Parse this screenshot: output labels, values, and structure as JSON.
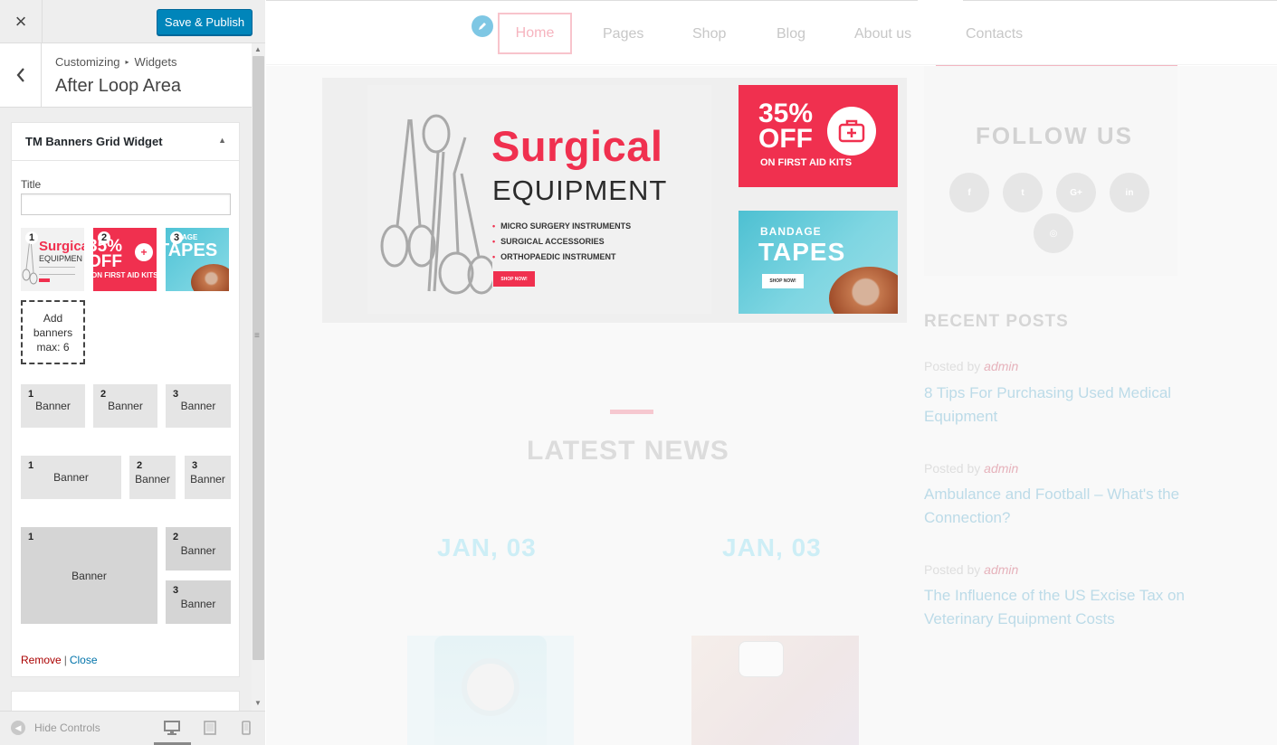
{
  "header": {
    "close_label": "×",
    "save_publish_label": "Save & Publish"
  },
  "panel": {
    "breadcrumb_root": "Customizing",
    "breadcrumb_sep": "▸",
    "breadcrumb_section": "Widgets",
    "title": "After Loop Area"
  },
  "widget": {
    "name": "TM Banners Grid Widget",
    "title_label": "Title",
    "title_value": "",
    "banners": [
      {
        "num": "1",
        "thumb_text": "Surgica",
        "thumb_sub": "EQUIPMEN"
      },
      {
        "num": "2",
        "thumb_text": "35% OFF",
        "thumb_sub": "ON FIRST AID KITS"
      },
      {
        "num": "3",
        "thumb_text": "TAPES",
        "thumb_sub": "AGE"
      }
    ],
    "add_banners_label": "Add banners max: 6",
    "layouts": {
      "cell_label": "Banner",
      "nums": [
        "1",
        "2",
        "3"
      ]
    },
    "remove_label": "Remove",
    "sep": "|",
    "close_label": "Close"
  },
  "footer": {
    "hide_controls_label": "Hide Controls",
    "devices": [
      "desktop-icon",
      "tablet-icon",
      "mobile-icon"
    ]
  },
  "preview": {
    "nav": [
      "Home",
      "Pages",
      "Shop",
      "Blog",
      "About us",
      "Contacts"
    ],
    "banner_main": {
      "title": "Surgical",
      "subtitle": "EQUIPMENT",
      "items": [
        "MICRO SURGERY INSTRUMENTS",
        "SURGICAL ACCESSORIES",
        "ORTHOPAEDIC INSTRUMENT"
      ],
      "button": "SHOP NOW!"
    },
    "banner_promo": {
      "pct_line1": "35%",
      "pct_line2": "OFF",
      "sub": "ON FIRST AID KITS"
    },
    "banner_tapes": {
      "line1": "BANDAGE",
      "line2": "TAPES",
      "button": "SHOP NOW!"
    },
    "latest_news_title": "LATEST NEWS",
    "dates": [
      "JAN, 03",
      "JAN, 03"
    ],
    "follow_title": "FOLLOW US",
    "social": [
      "f",
      "t",
      "G+",
      "in",
      "◎"
    ],
    "recent_posts_title": "RECENT POSTS",
    "posted_by": "Posted by",
    "author": "admin",
    "posts": [
      "8 Tips For Purchasing Used Medical Equipment",
      "Ambulance and Football – What's the Connection?",
      "The Influence of the US Excise Tax on Veterinary Equipment Costs"
    ]
  },
  "colors": {
    "wp_blue": "#0085ba",
    "brand_red": "#f0304f",
    "brand_cyan": "#4fc3d6",
    "remove_red": "#aa0000",
    "link_blue": "#0073aa"
  }
}
